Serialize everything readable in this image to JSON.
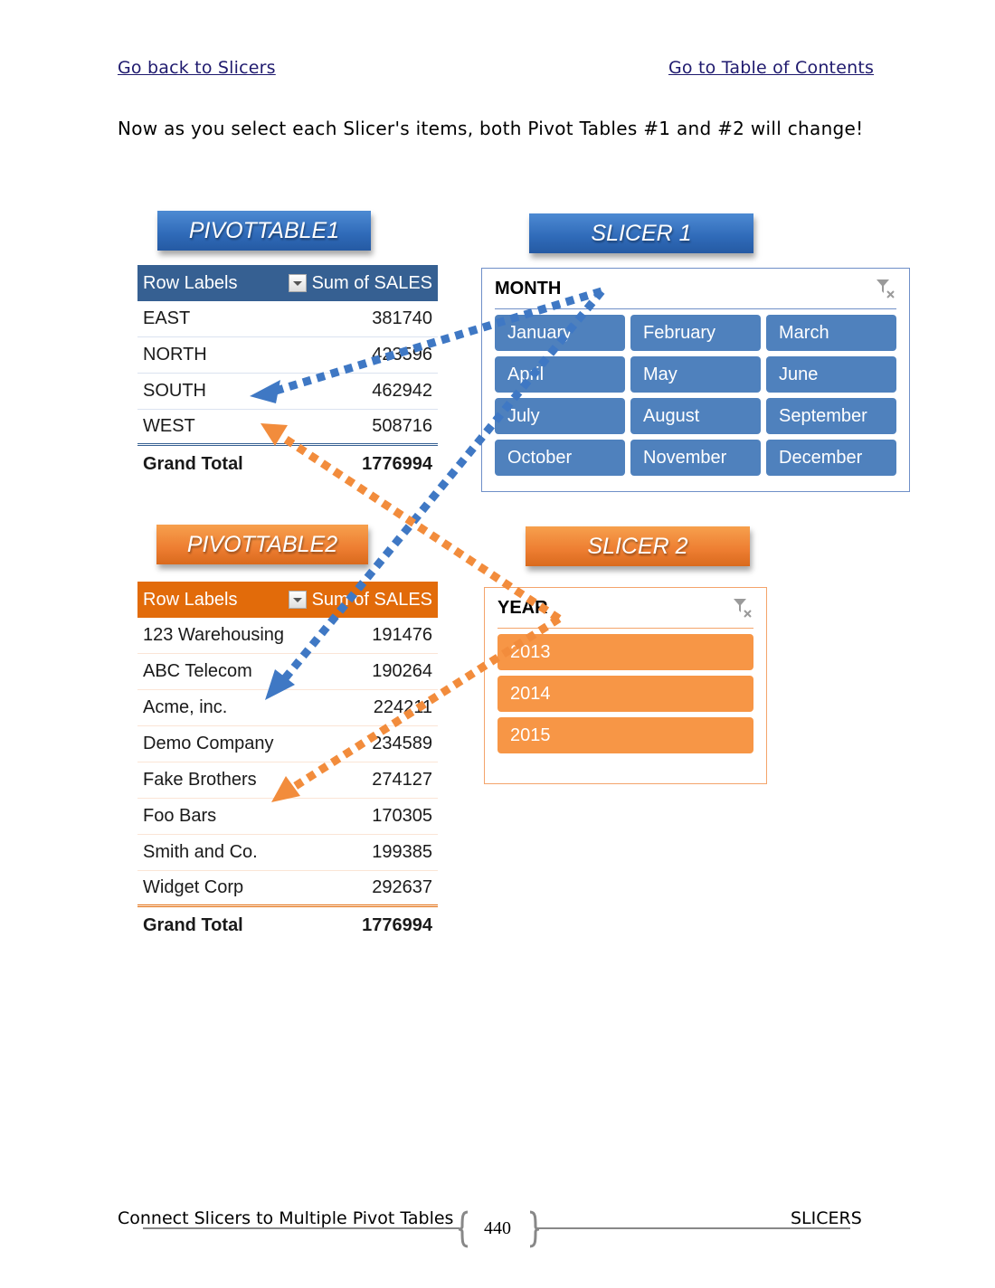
{
  "header": {
    "back_link": "Go back to Slicers",
    "toc_link": "Go to Table of Contents"
  },
  "intro_text": "Now as you select each Slicer's items, both Pivot Tables #1 and #2 will change!",
  "pivot1": {
    "banner": "PIVOTTABLE1",
    "col_row_labels": "Row Labels",
    "col_sum": "Sum of SALES",
    "rows": [
      {
        "label": "EAST",
        "value": "381740"
      },
      {
        "label": "NORTH",
        "value": "423596"
      },
      {
        "label": "SOUTH",
        "value": "462942"
      },
      {
        "label": "WEST",
        "value": "508716"
      }
    ],
    "total_label": "Grand Total",
    "total_value": "1776994"
  },
  "pivot2": {
    "banner": "PIVOTTABLE2",
    "col_row_labels": "Row Labels",
    "col_sum": "Sum of SALES",
    "rows": [
      {
        "label": "123 Warehousing",
        "value": "191476"
      },
      {
        "label": "ABC Telecom",
        "value": "190264"
      },
      {
        "label": "Acme, inc.",
        "value": "224211"
      },
      {
        "label": "Demo Company",
        "value": "234589"
      },
      {
        "label": "Fake Brothers",
        "value": "274127"
      },
      {
        "label": "Foo Bars",
        "value": "170305"
      },
      {
        "label": "Smith and Co.",
        "value": "199385"
      },
      {
        "label": "Widget Corp",
        "value": "292637"
      }
    ],
    "total_label": "Grand Total",
    "total_value": "1776994"
  },
  "slicer1": {
    "banner": "SLICER 1",
    "field": "MONTH",
    "clear_icon": "clear-filter-icon",
    "items": [
      "January",
      "February",
      "March",
      "April",
      "May",
      "June",
      "July",
      "August",
      "September",
      "October",
      "November",
      "December"
    ]
  },
  "slicer2": {
    "banner": "SLICER 2",
    "field": "YEAR",
    "clear_icon": "clear-filter-icon",
    "items": [
      "2013",
      "2014",
      "2015"
    ]
  },
  "colors": {
    "blue_accent": "#4f81bd",
    "blue_header": "#366092",
    "orange_accent": "#f79646",
    "orange_header": "#e26b0a"
  },
  "footer": {
    "chapter_title": "Connect Slicers to Multiple Pivot Tables",
    "page_number": "440",
    "section": "SLICERS"
  }
}
